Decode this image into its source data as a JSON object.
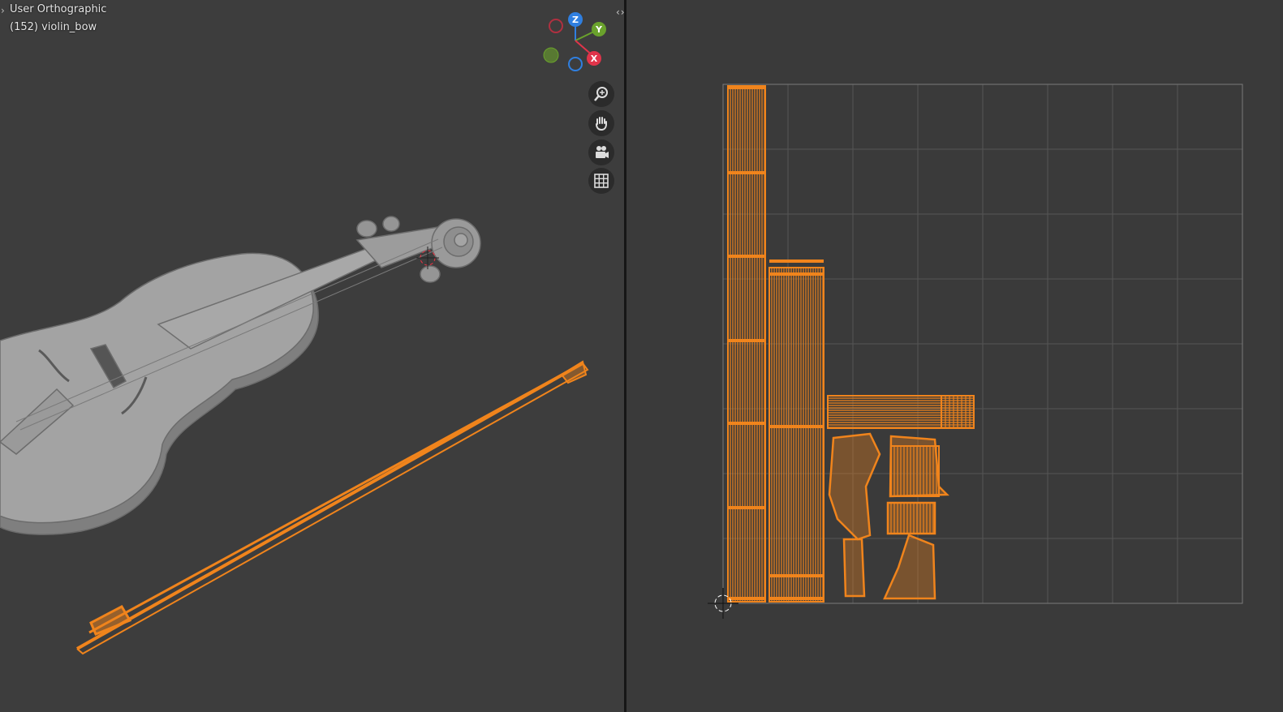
{
  "viewport": {
    "view_name": "User Orthographic",
    "object_label": "(152) violin_bow",
    "gizmo_axes": {
      "z": "Z",
      "y": "Y",
      "x": "X"
    },
    "nav_buttons": [
      "zoom-icon",
      "pan-hand-icon",
      "camera-icon",
      "grid-icon"
    ]
  },
  "colors": {
    "selection": "#f0841c",
    "background_3d": "#3d3d3d",
    "background_uv": "#3a3a3a",
    "axis_x": "#e0344a",
    "axis_y": "#6aa22c",
    "axis_z": "#2f7fe0"
  }
}
